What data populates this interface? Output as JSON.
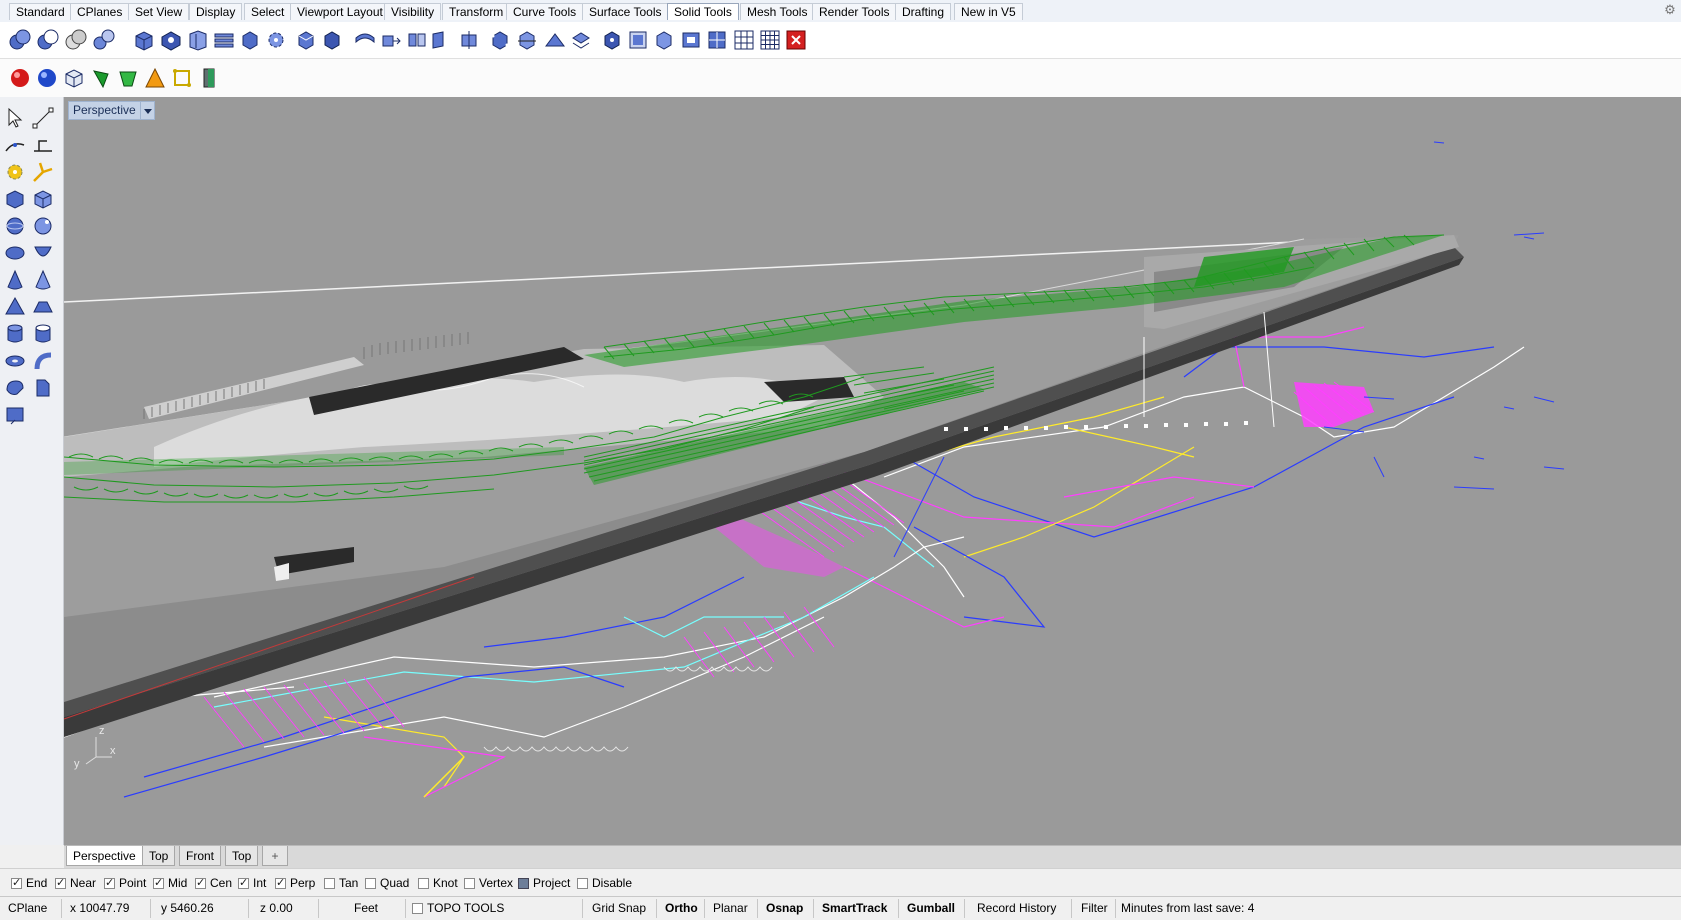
{
  "tabs": [
    "Standard",
    "CPlanes",
    "Set View",
    "Display",
    "Select",
    "Viewport Layout",
    "Visibility",
    "Transform",
    "Curve Tools",
    "Surface Tools",
    "Solid Tools",
    "Mesh Tools",
    "Render Tools",
    "Drafting",
    "New in V5"
  ],
  "active_tab": "Solid Tools",
  "toolbar_icons_row1": [
    "boolean-union-icon",
    "boolean-difference-icon",
    "boolean-intersection-icon",
    "boolean-split-icon",
    "box-icon",
    "extrude-icon",
    "cap-icon",
    "shell-icon",
    "solid-cube-icon",
    "gear-solid-icon",
    "box-edit-icon",
    "box-face-icon",
    "move-face-icon",
    "extrude-face-icon",
    "push-pull-icon",
    "offset-face-icon",
    "split-face-icon",
    "wireframe-box-icon",
    "cut-box-icon",
    "fold-icon",
    "move-edge-icon",
    "solid-points-icon",
    "create-solid-icon",
    "history-box-icon",
    "layer-box-icon",
    "grid-box-icon",
    "dots-grid-icon",
    "close-red-icon"
  ],
  "toolbar_icons_row2": [
    "red-sphere-icon",
    "blue-sphere-icon",
    "mesh-box-icon",
    "green-render-icon",
    "environment-icon",
    "cone-warning-icon",
    "frame-icon",
    "door-icon"
  ],
  "left_tools": [
    "select-arrow-icon",
    "points-icon",
    "curve-icon",
    "curve-edit-icon",
    "gear-tool-icon",
    "explode-icon",
    "box-solid-icon",
    "box-edit-solid-icon",
    "sphere-icon",
    "sphere-edit-icon",
    "ellipsoid-icon",
    "paraboloid-icon",
    "cone-icon",
    "cone-edit-icon",
    "pyramid-icon",
    "truncated-pyramid-icon",
    "cylinder-icon",
    "tube-icon",
    "torus-icon",
    "pipe-icon",
    "rotate-icon",
    "extrude-solid-icon",
    "text-object-icon"
  ],
  "viewport": {
    "title": "Perspective",
    "axis_labels": {
      "x": "x",
      "y": "y",
      "z": "z"
    },
    "colors": {
      "background": "#9a9a9a",
      "terrain": "#6e6e6e",
      "green_wire": "#1f9a1f",
      "magenta": "#ff40ff",
      "blue": "#2a3cff",
      "yellow": "#ffeb2a",
      "white": "#ffffff",
      "cyan": "#7ff"
    }
  },
  "viewport_tabs": [
    "Perspective",
    "Top",
    "Front",
    "Top"
  ],
  "add_tab_icon": "plus-icon",
  "osnaps": [
    {
      "label": "End",
      "checked": true
    },
    {
      "label": "Near",
      "checked": true
    },
    {
      "label": "Point",
      "checked": true
    },
    {
      "label": "Mid",
      "checked": true
    },
    {
      "label": "Cen",
      "checked": true
    },
    {
      "label": "Int",
      "checked": true
    },
    {
      "label": "Perp",
      "checked": true
    },
    {
      "label": "Tan",
      "checked": false
    },
    {
      "label": "Quad",
      "checked": false
    },
    {
      "label": "Knot",
      "checked": false
    },
    {
      "label": "Vertex",
      "checked": false
    },
    {
      "label": "Project",
      "checked": true
    },
    {
      "label": "Disable",
      "checked": false
    }
  ],
  "status": {
    "cplane": "CPlane",
    "x": "x 10047.79",
    "y": "y 5460.26",
    "z": "z 0.00",
    "units": "Feet",
    "layer": "TOPO TOOLS",
    "grid_snap": "Grid Snap",
    "ortho": "Ortho",
    "planar": "Planar",
    "osnap": "Osnap",
    "smarttrack": "SmartTrack",
    "gumball": "Gumball",
    "record_history": "Record History",
    "filter": "Filter",
    "minutes": "Minutes from last save: 4"
  }
}
